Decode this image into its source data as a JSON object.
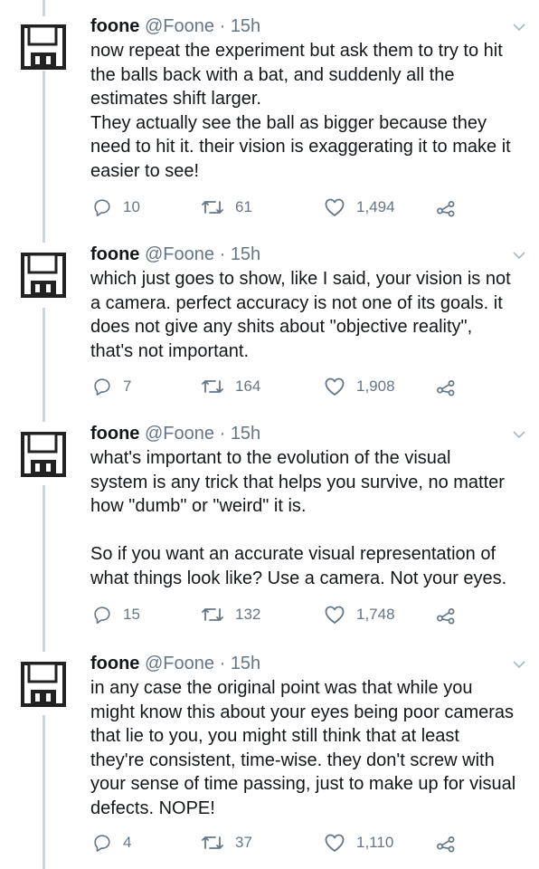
{
  "tweets": [
    {
      "name": "foone",
      "handle": "@Foone",
      "separator": "·",
      "time": "15h",
      "text": "now repeat the experiment but ask them to try to hit\nthe balls back with a bat, and suddenly all the\nestimates shift larger.\nThey actually see the ball as bigger because they\nneed to hit it. their vision is exaggerating it to make it\neasier to see!",
      "replies": "10",
      "retweets": "61",
      "likes": "1,494"
    },
    {
      "name": "foone",
      "handle": "@Foone",
      "separator": "·",
      "time": "15h",
      "text": "which just goes to show, like I said, your vision is not\na camera. perfect accuracy is not one of its goals. it\ndoes not give any shits about \"objective reality\",\nthat's not important.",
      "replies": "7",
      "retweets": "164",
      "likes": "1,908"
    },
    {
      "name": "foone",
      "handle": "@Foone",
      "separator": "·",
      "time": "15h",
      "text": "what's important to the evolution of the visual\nsystem is any trick that helps you survive, no matter\nhow \"dumb\" or \"weird\" it is.\n\nSo if you want an accurate visual representation of\nwhat things look like? Use a camera. Not your eyes.",
      "replies": "15",
      "retweets": "132",
      "likes": "1,748"
    },
    {
      "name": "foone",
      "handle": "@Foone",
      "separator": "·",
      "time": "15h",
      "text": "in any case the original point was that while you\nmight know this about your eyes being poor cameras\nthat lie to you, you might still think that at least\nthey're consistent, time-wise. they don't screw with\nyour sense of time passing, just to make up for visual\ndefects. NOPE!",
      "replies": "4",
      "retweets": "37",
      "likes": "1,110"
    }
  ],
  "icons": {
    "avatar": "floppy-disk-icon",
    "caret": "chevron-down-icon",
    "reply": "reply-icon",
    "retweet": "retweet-icon",
    "like": "heart-icon",
    "share": "share-icon"
  },
  "colors": {
    "text": "#14171a",
    "secondary": "#657786",
    "thread_line": "#ccd6dd"
  }
}
